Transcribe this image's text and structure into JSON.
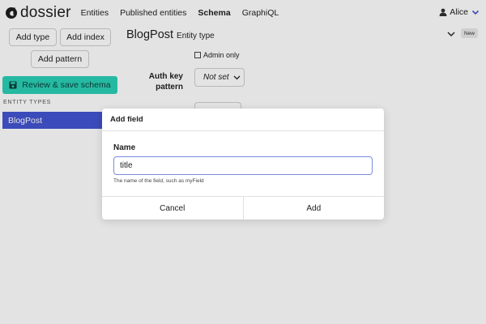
{
  "navbar": {
    "brand": "dossier",
    "links": [
      {
        "label": "Entities",
        "active": false
      },
      {
        "label": "Published entities",
        "active": false
      },
      {
        "label": "Schema",
        "active": true
      },
      {
        "label": "GraphiQL",
        "active": false
      }
    ],
    "user": {
      "name": "Alice",
      "icon": "user-icon",
      "menu_icon": "chevron-down-icon"
    }
  },
  "sidebar": {
    "add_type_label": "Add type",
    "add_index_label": "Add index",
    "add_pattern_label": "Add pattern",
    "review_save_label": "Review & save schema",
    "section_label": "Entity types",
    "types": [
      {
        "label": "BlogPost",
        "selected": true
      }
    ]
  },
  "editor": {
    "entity_name": "BlogPost",
    "entity_kind": "Entity type",
    "new_badge": "New",
    "admin_only_label": "Admin only",
    "admin_only_checked": false,
    "auth_key_pattern_label": "Auth key pattern",
    "auth_key_pattern_value": "Not set"
  },
  "dialog": {
    "title": "Add field",
    "name_label": "Name",
    "name_value": "title",
    "name_help": "The name of the field, such as myField",
    "cancel_label": "Cancel",
    "add_label": "Add"
  },
  "colors": {
    "primary_button": "#2bd0b6",
    "selected_item": "#4355d1",
    "focused_input_border": "#7b8cdf",
    "overlay": "#e3e3e3"
  }
}
